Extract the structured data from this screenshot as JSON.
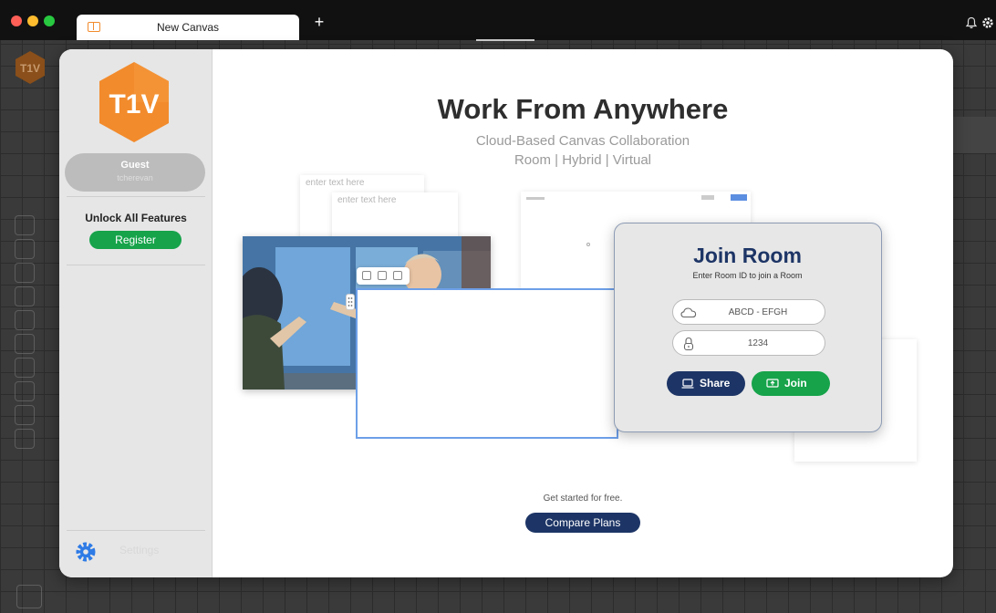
{
  "window": {
    "tab_title": "New Canvas",
    "new_tab": "+"
  },
  "sidebar": {
    "logo_text": "T1V",
    "guest_name": "Guest",
    "guest_username": "tcherevan",
    "unlock": "Unlock All Features",
    "register": "Register",
    "settings": "Settings"
  },
  "main": {
    "headline": "Work From Anywhere",
    "subtitle_1": "Cloud-Based Canvas Collaboration",
    "subtitle_2": "Room | Hybrid | Virtual",
    "note_1": "enter text here",
    "note_2": "enter text here",
    "get_started": "Get started for free.",
    "compare_plans": "Compare Plans"
  },
  "join_room": {
    "title": "Join Room",
    "subtitle": "Enter Room ID to join a Room",
    "room_id_placeholder": "ABCD - EFGH",
    "passcode_placeholder": "1234",
    "share_label": "Share",
    "join_label": "Join"
  },
  "colors": {
    "brand_orange": "#f28b2c",
    "navy": "#1d3566",
    "green": "#16a34a",
    "settings_blue": "#2e7be6"
  },
  "icons": [
    "canvas-tab-icon",
    "bell-icon",
    "gear-icon",
    "cloud-icon",
    "lock-icon",
    "laptop-icon",
    "join-screen-icon",
    "drag-handle-icon"
  ]
}
